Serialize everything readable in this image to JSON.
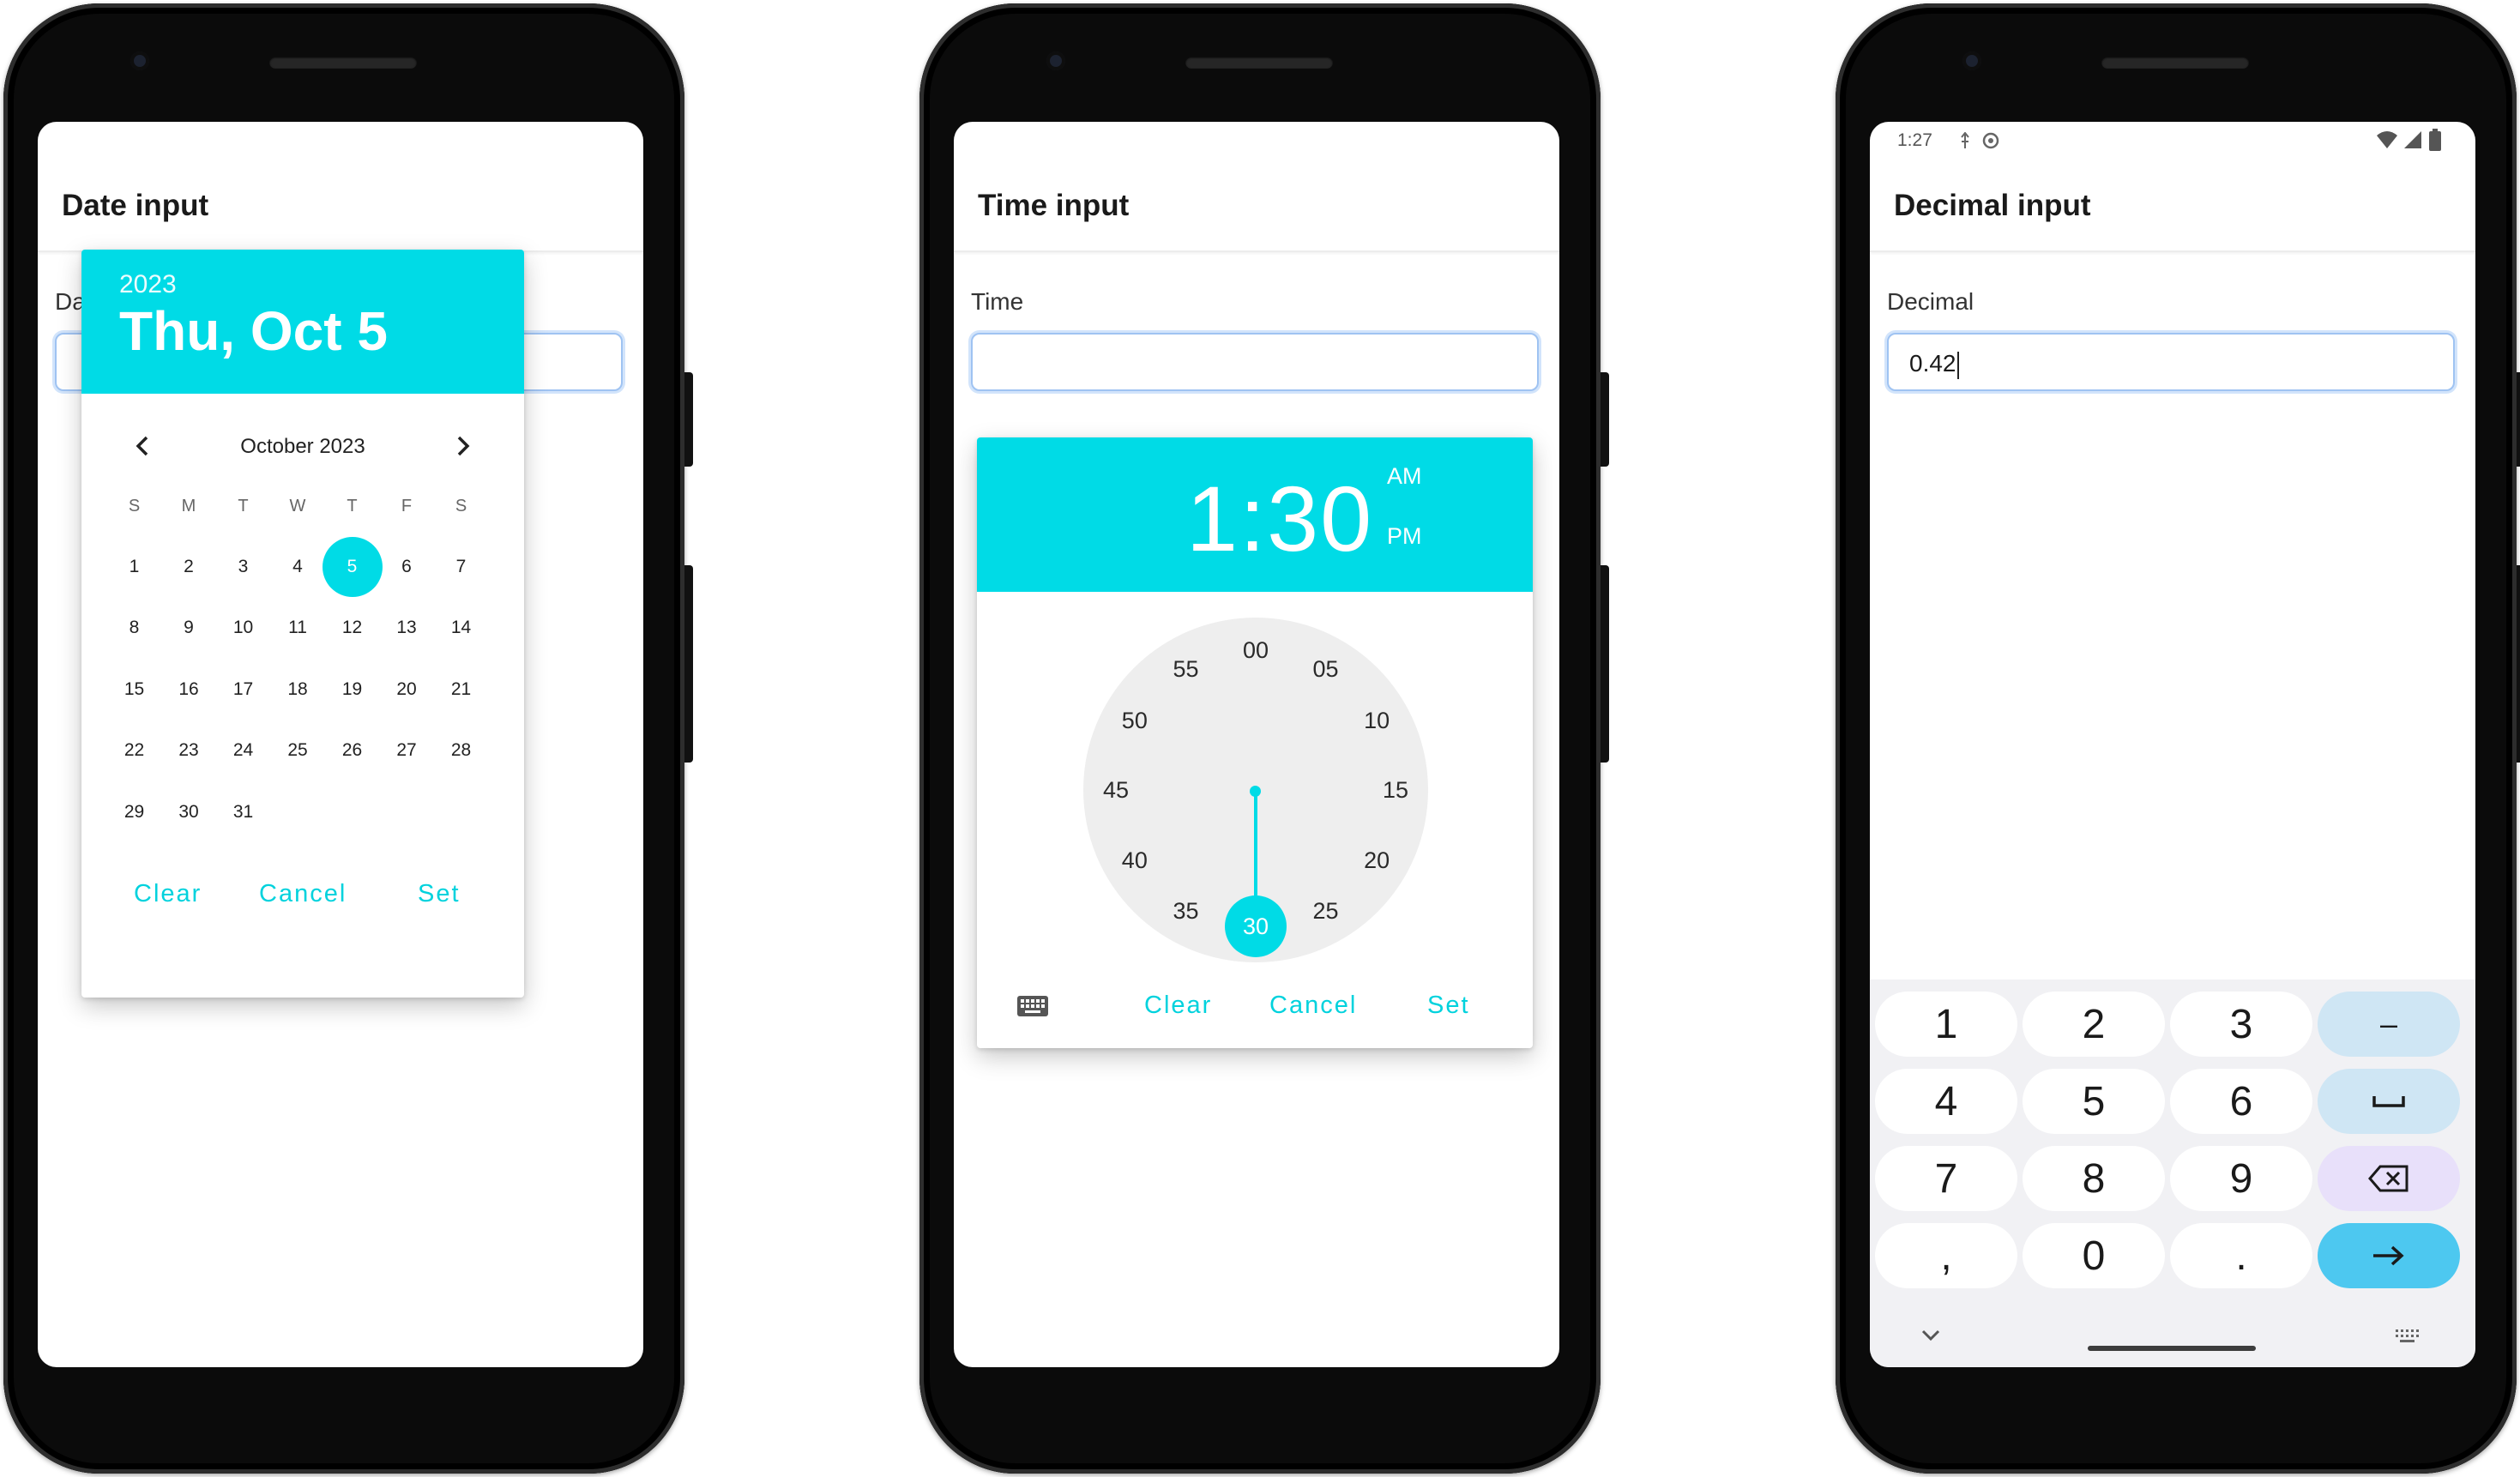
{
  "phones": {
    "date": {
      "appbar_title": "Date input",
      "field_label": "Date",
      "field_value": "",
      "dialog": {
        "year": "2023",
        "selected_label": "Thu, Oct 5",
        "month_label": "October 2023",
        "weekday_headers": [
          "S",
          "M",
          "T",
          "W",
          "T",
          "F",
          "S"
        ],
        "days": [
          "1",
          "2",
          "3",
          "4",
          "5",
          "6",
          "7",
          "8",
          "9",
          "10",
          "11",
          "12",
          "13",
          "14",
          "15",
          "16",
          "17",
          "18",
          "19",
          "20",
          "21",
          "22",
          "23",
          "24",
          "25",
          "26",
          "27",
          "28",
          "29",
          "30",
          "31"
        ],
        "first_weekday_index": 0,
        "selected_day": "5",
        "actions": {
          "clear": "Clear",
          "cancel": "Cancel",
          "set": "Set"
        }
      }
    },
    "time": {
      "appbar_title": "Time input",
      "field_label": "Time",
      "field_value": "",
      "dialog": {
        "time_display": "1:30",
        "am": "AM",
        "pm": "PM",
        "minutes": [
          "00",
          "05",
          "10",
          "15",
          "20",
          "25",
          "30",
          "35",
          "40",
          "45",
          "50",
          "55"
        ],
        "selected_minute": "30",
        "actions": {
          "clear": "Clear",
          "cancel": "Cancel",
          "set": "Set"
        }
      }
    },
    "decimal": {
      "status_time": "1:27",
      "appbar_title": "Decimal input",
      "field_label": "Decimal",
      "field_value": "0.42",
      "keys": {
        "k1": "1",
        "k2": "2",
        "k3": "3",
        "minus": "–",
        "k4": "4",
        "k5": "5",
        "k6": "6",
        "k7": "7",
        "k8": "8",
        "k9": "9",
        "comma": ",",
        "k0": "0",
        "dot": "."
      }
    }
  },
  "colors": {
    "accent": "#00dbe6",
    "key_side": "#cfe6f4",
    "key_delete": "#e8e0fa",
    "key_go": "#4dc8f0"
  },
  "icons": [
    "chevron-left-icon",
    "chevron-right-icon",
    "keyboard-icon",
    "space-bar-icon",
    "backspace-icon",
    "arrow-right-icon",
    "chevron-down-icon",
    "wifi-icon",
    "signal-icon",
    "battery-icon"
  ]
}
